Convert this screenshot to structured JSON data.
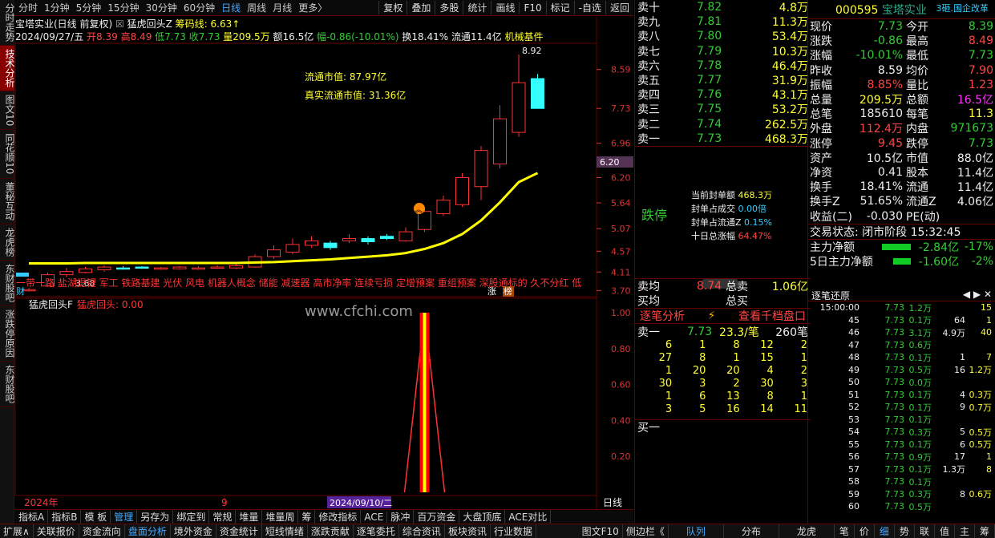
{
  "left_tabs": [
    "分时走势",
    "技术分析",
    "图文10",
    "同花顺10",
    "董秘互动",
    "龙虎榜",
    "东财股吧",
    "涨跌停原因",
    "东财股吧"
  ],
  "topbar": {
    "periods": [
      "分时",
      "1分钟",
      "5分钟",
      "15分钟",
      "30分钟",
      "60分钟",
      "日线",
      "周线",
      "月线",
      "更多〉"
    ],
    "active_period": "日线",
    "tools": [
      "复权",
      "叠加",
      "多股",
      "统计",
      "画线",
      "F10",
      "标记",
      "-自选",
      "返回"
    ]
  },
  "chart": {
    "title": "宝塔实业(日线 前复权)",
    "indicator_name": "猛虎回头Z",
    "indicator_extra": "筹码线: 6.63↑",
    "date": "2024/09/27/五",
    "open_label": "开8.39",
    "high_label": "高8.49",
    "low_label": "低7.73",
    "close_label": "收7.73",
    "vol_label": "量209.5万",
    "amount_label": "额16.5亿",
    "change_label": "幅-0.86(-10.01%)",
    "turnover_label": "换18.41%",
    "float_label": "流通11.4亿",
    "sector_label": "机械基件",
    "float_mktval": "流通市值: 87.97亿",
    "real_float_mktval": "真实流通市值: 31.36亿",
    "price_axis": [
      "8.59",
      "7.73",
      "6.96",
      "6.20",
      "5.64",
      "5.07",
      "4.57",
      "4.11",
      "3.70"
    ],
    "current_price_tag": "6.20",
    "high_mark": "8.92",
    "low_mark": "3.68",
    "concepts": "一带一路 盐湖提锂 军工 铁路基建 光伏 风电 机器人概念 储能 减速器 高市净率 连续亏损 定增预案 重组预案 深股通标的 久不分红 低",
    "tag_zhang": "涨",
    "tag_bang": "榜",
    "tag_cai": "财",
    "sub_title": "猛虎回头F",
    "sub_value": "猛虎回头: 0.00",
    "sub_axis": [
      "1.00",
      "0.80",
      "0.60",
      "0.40",
      "0.20"
    ],
    "watermark": "www.cfchi.com",
    "date_axis": [
      "2024年",
      "9",
      "2024/09/10/二"
    ],
    "right_axis_label": "日线"
  },
  "chart_data": {
    "type": "candlestick",
    "categories": [
      "1",
      "2",
      "3",
      "4",
      "5",
      "6",
      "7",
      "8",
      "9",
      "10",
      "11",
      "12",
      "13",
      "14",
      "15",
      "16",
      "17",
      "18",
      "19",
      "20",
      "21",
      "22",
      "23",
      "24",
      "25",
      "26",
      "27",
      "28"
    ],
    "series": [
      {
        "name": "K",
        "open": [
          3.7,
          3.8,
          4.05,
          4.1,
          4.16,
          4.2,
          4.22,
          4.18,
          4.18,
          4.18,
          4.22,
          4.2,
          4.22,
          4.45,
          4.55,
          4.7,
          4.75,
          4.8,
          4.85,
          4.9,
          4.8,
          5.05,
          5.4,
          5.6,
          6.0,
          6.5,
          7.2,
          8.39
        ],
        "close": [
          3.72,
          4.05,
          4.12,
          4.18,
          4.22,
          4.18,
          4.2,
          4.2,
          4.22,
          4.2,
          4.22,
          4.25,
          4.45,
          4.6,
          4.72,
          4.8,
          4.65,
          4.85,
          4.78,
          4.85,
          5.0,
          5.45,
          5.7,
          6.2,
          6.8,
          7.5,
          8.3,
          7.73
        ],
        "high": [
          3.75,
          4.1,
          4.2,
          4.22,
          4.26,
          4.24,
          4.24,
          4.22,
          4.24,
          4.24,
          4.26,
          4.28,
          4.5,
          4.7,
          4.85,
          4.9,
          4.8,
          4.95,
          4.9,
          4.95,
          5.1,
          5.5,
          5.8,
          6.3,
          6.9,
          7.8,
          8.92,
          8.49
        ],
        "low": [
          3.68,
          3.78,
          4.0,
          4.08,
          4.12,
          4.16,
          4.18,
          4.16,
          4.16,
          4.16,
          4.18,
          4.18,
          4.2,
          4.4,
          4.5,
          4.65,
          4.6,
          4.75,
          4.72,
          4.82,
          4.78,
          5.0,
          5.35,
          5.55,
          5.7,
          6.4,
          7.1,
          7.73
        ]
      },
      {
        "name": "筹码线",
        "values": [
          4.3,
          4.3,
          4.3,
          4.31,
          4.31,
          4.31,
          4.31,
          4.31,
          4.31,
          4.31,
          4.31,
          4.31,
          4.32,
          4.33,
          4.35,
          4.37,
          4.39,
          4.42,
          4.45,
          4.48,
          4.53,
          4.62,
          4.75,
          4.95,
          5.25,
          5.65,
          6.1,
          6.3
        ]
      }
    ],
    "sub_signal": [
      0,
      0,
      0,
      0,
      0,
      0,
      0,
      0,
      0,
      0,
      0,
      0,
      0,
      0,
      0,
      0,
      0,
      0,
      0,
      0,
      0,
      1,
      0,
      0,
      0,
      0,
      0,
      0
    ],
    "ylim": [
      3.6,
      9.1
    ]
  },
  "orderbook": {
    "asks": [
      {
        "label": "卖十",
        "price": "7.82",
        "vol": "4.8万"
      },
      {
        "label": "卖九",
        "price": "7.81",
        "vol": "11.3万"
      },
      {
        "label": "卖八",
        "price": "7.80",
        "vol": "53.4万"
      },
      {
        "label": "卖七",
        "price": "7.79",
        "vol": "10.3万"
      },
      {
        "label": "卖六",
        "price": "7.78",
        "vol": "46.4万"
      },
      {
        "label": "卖五",
        "price": "7.77",
        "vol": "31.9万"
      },
      {
        "label": "卖四",
        "price": "7.76",
        "vol": "43.1万"
      },
      {
        "label": "卖三",
        "price": "7.75",
        "vol": "53.2万"
      },
      {
        "label": "卖二",
        "price": "7.74",
        "vol": "262.5万"
      },
      {
        "label": "卖一",
        "price": "7.73",
        "vol": "468.3万"
      }
    ],
    "status": "跌停",
    "seal_amount": "当前封单额",
    "seal_amount_val": "468.3万",
    "seal_ratio": "封单占成交",
    "seal_ratio_val": "0.00倍",
    "seal_float": "封单占流通Z",
    "seal_float_val": "0.15%",
    "ten_day": "十日总涨幅",
    "ten_day_val": "64.47%",
    "avg_label": "卖均",
    "avg_val": "8.74",
    "total_sell": "总卖",
    "total_sell_val": "1.06亿",
    "buy_avg": "买均",
    "total_buy": "总买",
    "tick_analysis": "逐笔分析",
    "view_depth": "查看千档盘口",
    "s1_label": "卖一",
    "s1_price": "7.73",
    "s1_per": "23.3/笔",
    "s1_count": "260笔",
    "grid": [
      [
        "6",
        "1",
        "8",
        "12",
        "2"
      ],
      [
        "27",
        "8",
        "1",
        "15",
        "1"
      ],
      [
        "1",
        "20",
        "20",
        "4",
        "2"
      ],
      [
        "30",
        "3",
        "2",
        "30",
        "3"
      ],
      [
        "1",
        "6",
        "13",
        "8",
        "1"
      ],
      [
        "3",
        "5",
        "16",
        "14",
        "11"
      ]
    ],
    "b1_label": "买一"
  },
  "fund": {
    "code": "000595",
    "name": "宝塔实业",
    "badge": "3砸.国企改革",
    "rows": [
      [
        "现价",
        "7.73",
        "今开",
        "8.39"
      ],
      [
        "涨跌",
        "-0.86",
        "最高",
        "8.49"
      ],
      [
        "涨幅",
        "-10.01%",
        "最低",
        "7.73"
      ],
      [
        "昨收",
        "8.59",
        "均价",
        "7.90"
      ],
      [
        "振幅",
        "8.85%",
        "量比",
        "1.23"
      ],
      [
        "总量",
        "209.5万",
        "总额",
        "16.5亿"
      ],
      [
        "总笔",
        "185610",
        "每笔",
        "11.3"
      ],
      [
        "外盘",
        "112.4万",
        "内盘",
        "971673"
      ],
      [
        "涨停",
        "9.45",
        "跌停",
        "7.73"
      ],
      [
        "资产",
        "10.5亿",
        "市值",
        "88.0亿"
      ],
      [
        "净资",
        "0.41",
        "股本",
        "11.4亿"
      ],
      [
        "换手",
        "18.41%",
        "流通",
        "11.4亿"
      ],
      [
        "换手Z",
        "51.65%",
        "流通Z",
        "4.06亿"
      ],
      [
        "收益(二)",
        "-0.030",
        "PE(动)",
        ""
      ]
    ],
    "trade_state": "交易状态: 闭市阶段 15:32:45",
    "main_net": "主力净额",
    "main_net_val": "-2.84亿",
    "main_net_pct": "-17%",
    "five_day": "5日主力净额",
    "five_day_val": "-1.60亿",
    "five_day_pct": "-2%"
  },
  "ticks": {
    "title": "逐笔还原",
    "rows": [
      [
        "15:00:00",
        "7.73",
        "1.2万",
        "",
        "15"
      ],
      [
        "45",
        "7.73",
        "0.1万",
        "64",
        "1"
      ],
      [
        "46",
        "7.73",
        "3.1万",
        "4.9万",
        "40"
      ],
      [
        "47",
        "7.73",
        "0.6万",
        "",
        ""
      ],
      [
        "48",
        "7.73",
        "0.1万",
        "1",
        "7"
      ],
      [
        "49",
        "7.73",
        "0.5万",
        "16",
        "1.2万"
      ],
      [
        "50",
        "7.73",
        "0.0万",
        "",
        ""
      ],
      [
        "51",
        "7.73",
        "0.1万",
        "4",
        "0.3万"
      ],
      [
        "52",
        "7.73",
        "0.1万",
        "9",
        "0.7万"
      ],
      [
        "53",
        "7.73",
        "0.1万",
        "",
        ""
      ],
      [
        "54",
        "7.73",
        "0.3万",
        "5",
        "0.5万"
      ],
      [
        "55",
        "7.73",
        "0.1万",
        "6",
        "0.5万"
      ],
      [
        "56",
        "7.73",
        "0.9万",
        "17",
        "1"
      ],
      [
        "57",
        "7.73",
        "0.1万",
        "1.3万",
        "8"
      ],
      [
        "58",
        "7.73",
        "0.1万",
        "",
        ""
      ],
      [
        "59",
        "7.73",
        "0.3万",
        "8",
        "0.6万"
      ],
      [
        "60",
        "7.73",
        "0.5万",
        "",
        ""
      ]
    ]
  },
  "indicator_tabs": [
    "指标A",
    "指标B",
    "模 板",
    "管理",
    "另存为",
    "绑定到",
    "常规",
    "堆量",
    "堆量周",
    "筹",
    "修改指标",
    "ACE",
    "脉冲",
    "百万资金",
    "大盘顶底",
    "ACE对比"
  ],
  "bottom_tabs": [
    "扩展∧",
    "关联报价",
    "资金流向",
    "盘面分析",
    "境外资金",
    "资金统计",
    "短线情绪",
    "涨跌贡献",
    "逐笔委托",
    "综合资讯",
    "板块资讯",
    "行业数据"
  ],
  "bottom_right": [
    "图文F10",
    "侧边栏《",
    "队列",
    "分布",
    "龙虎",
    "笔",
    "价",
    "细",
    "势",
    "联",
    "值",
    "主",
    "筹"
  ]
}
